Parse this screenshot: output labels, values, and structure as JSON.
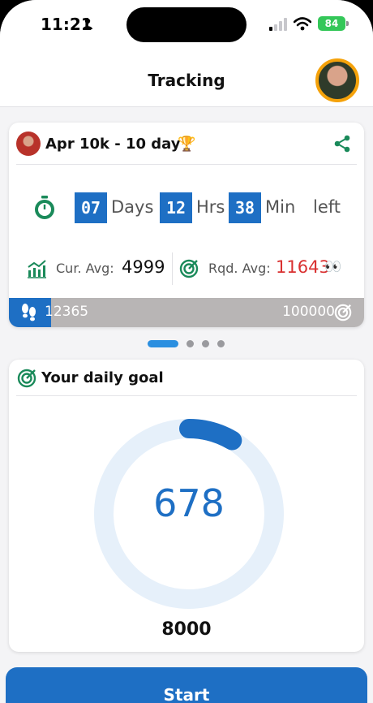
{
  "status_bar": {
    "time": "11:21",
    "battery": "84"
  },
  "header": {
    "title": "Tracking"
  },
  "challenge": {
    "title": "Apr 10k - 10 day",
    "countdown": {
      "days": "07",
      "days_label": "Days",
      "hours": "12",
      "hours_label": "Hrs",
      "minutes": "38",
      "minutes_label": "Min",
      "suffix": "left"
    },
    "current_avg_label": "Cur. Avg:",
    "current_avg": "4999",
    "required_avg_label": "Rqd. Avg:",
    "required_avg": "11643",
    "progress_current": "12365",
    "progress_target": "100000",
    "progress_fraction": 0.12365
  },
  "pager": {
    "pages": 4,
    "active": 0
  },
  "daily_goal": {
    "title": "Your daily goal",
    "steps_today": "678",
    "goal": "8000",
    "progress_fraction": 0.08475
  },
  "start_button": "Start",
  "colors": {
    "accent": "#1e6fc4",
    "green": "#1a8a5a",
    "red": "#d93030",
    "ring_track": "#e6f0fa",
    "progress_track": "#b8b5b5"
  }
}
